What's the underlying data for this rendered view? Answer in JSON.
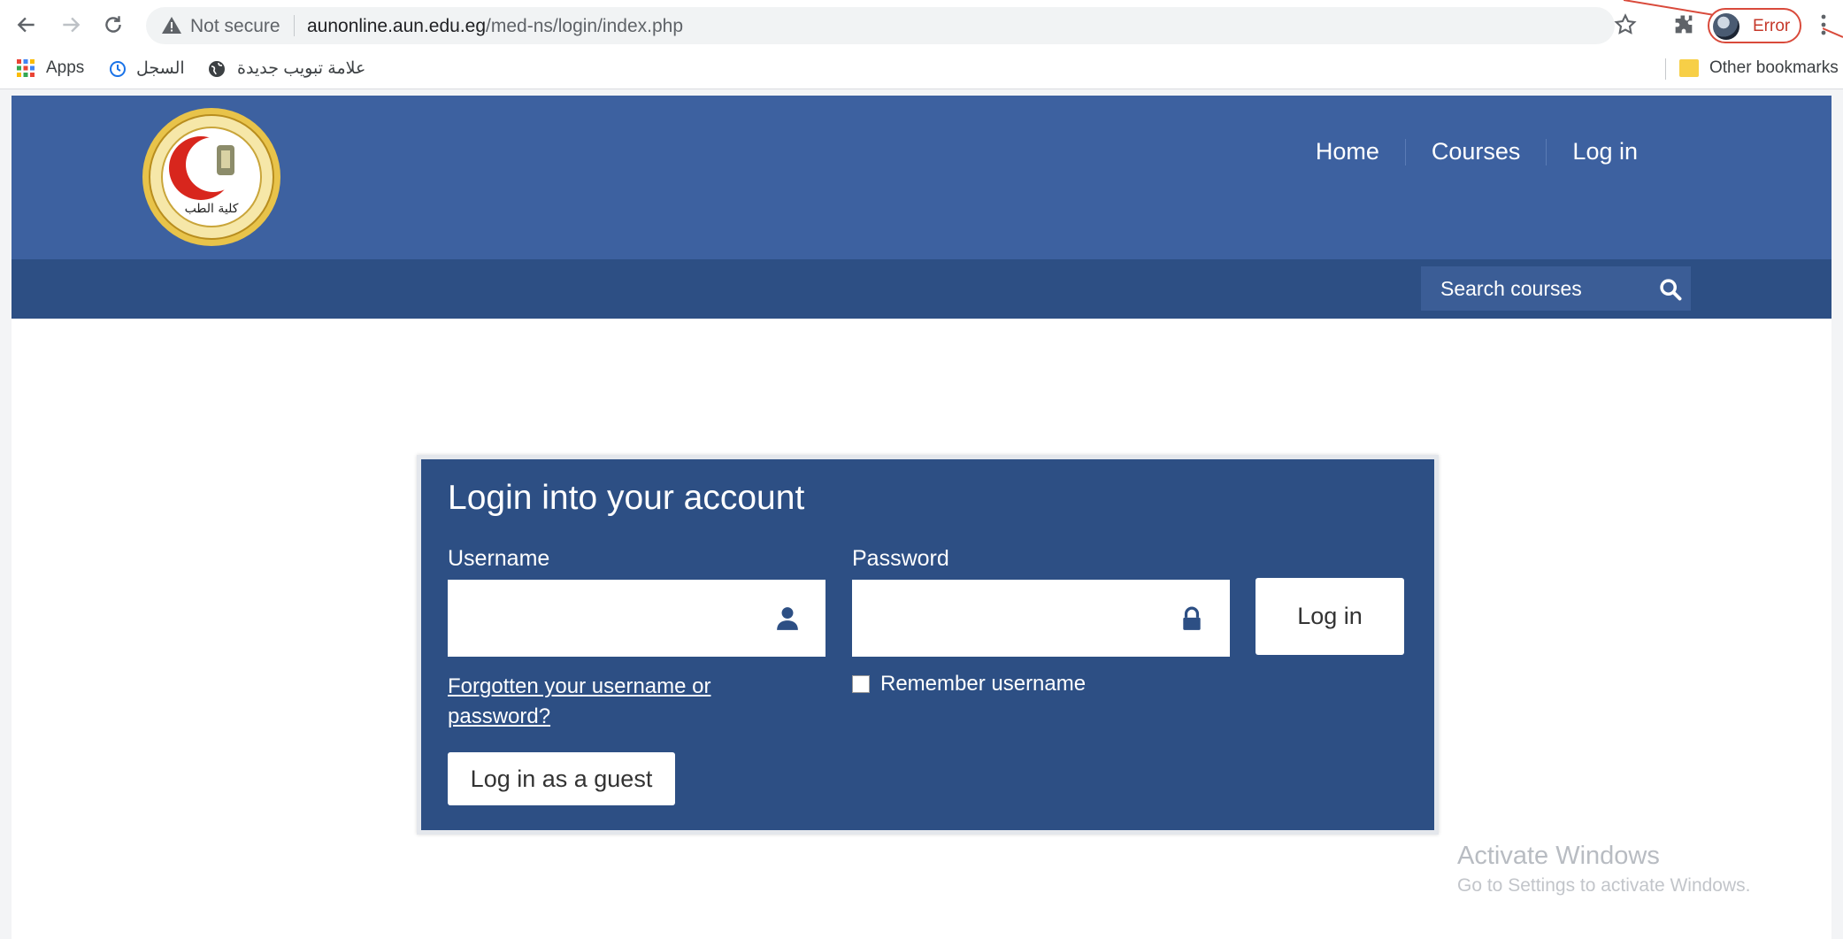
{
  "browser": {
    "not_secure_label": "Not secure",
    "url_host": "aunonline.aun.edu.eg",
    "url_path": "/med-ns/login/index.php",
    "profile_status": "Error",
    "bookmarks": [
      {
        "label": "Apps",
        "icon": "apps-grid-icon"
      },
      {
        "label": "السجل",
        "icon": "history-icon"
      },
      {
        "label": "علامة تبويب جديدة",
        "icon": "globe-icon"
      }
    ],
    "other_bookmarks": "Other bookmarks"
  },
  "site": {
    "logo_text": "كلية الطب",
    "nav": [
      "Home",
      "Courses",
      "Log in"
    ],
    "search_placeholder": "Search courses"
  },
  "login": {
    "title": "Login into your account",
    "username_label": "Username",
    "password_label": "Password",
    "login_button": "Log in",
    "forgot_link": "Forgotten your username or password?",
    "remember_label": "Remember username",
    "guest_button": "Log in as a guest"
  },
  "os_watermark": {
    "title": "Activate Windows",
    "subtitle": "Go to Settings to activate Windows."
  },
  "colors": {
    "header": "#3d61a0",
    "subbar": "#2d4f84",
    "card": "#2d4f84",
    "error": "#d94a3b"
  }
}
